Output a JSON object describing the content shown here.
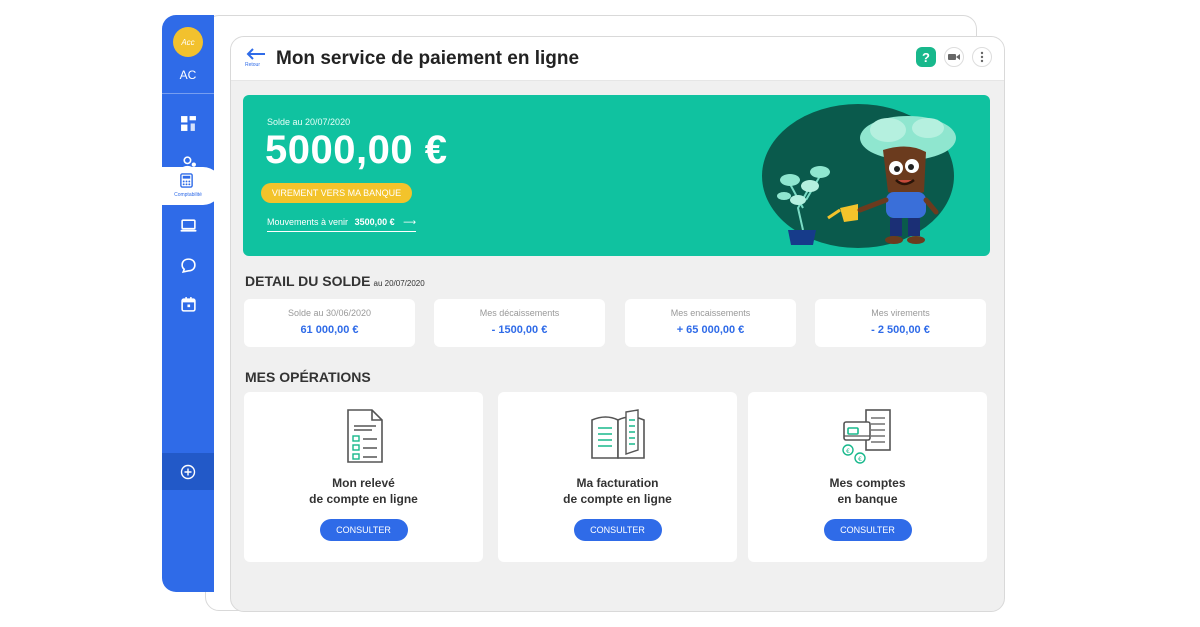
{
  "sidebar": {
    "logo_text": "Acc",
    "initials": "AC",
    "active_label": "Comptabilité",
    "icons": [
      "dashboard-icon",
      "contacts-icon",
      "calculator-icon",
      "laptop-icon",
      "chat-icon",
      "calendar-icon",
      "add-icon"
    ]
  },
  "header": {
    "back_label": "Retour",
    "title": "Mon service de paiement en ligne",
    "help_label": "?"
  },
  "balance": {
    "date_label": "Solde au 20/07/2020",
    "amount": "5000,00 €",
    "transfer_button": "VIREMENT VERS MA BANQUE",
    "upcoming_label": "Mouvements à venir",
    "upcoming_amount": "3500,00 €"
  },
  "detail": {
    "title": "DETAIL DU SOLDE",
    "date": "au 20/07/2020",
    "stats": [
      {
        "label": "Solde au 30/06/2020",
        "value": "61 000,00 €"
      },
      {
        "label": "Mes décaissements",
        "value": "- 1500,00 €"
      },
      {
        "label": "Mes encaissements",
        "value": "+ 65 000,00 €"
      },
      {
        "label": "Mes virements",
        "value": "- 2 500,00 €"
      }
    ]
  },
  "operations": {
    "title": "MES OPÉRATIONS",
    "cards": [
      {
        "line1": "Mon relevé",
        "line2": "de compte en ligne",
        "button": "CONSULTER",
        "icon": "statement-document-icon"
      },
      {
        "line1": "Ma facturation",
        "line2": "de compte en ligne",
        "button": "CONSULTER",
        "icon": "open-book-icon"
      },
      {
        "line1": "Mes comptes",
        "line2": "en banque",
        "button": "CONSULTER",
        "icon": "bank-cards-icon"
      }
    ]
  },
  "colors": {
    "primary": "#2f6be8",
    "teal": "#10c2a0",
    "yellow": "#f3c32b",
    "help_green": "#18b88c"
  }
}
